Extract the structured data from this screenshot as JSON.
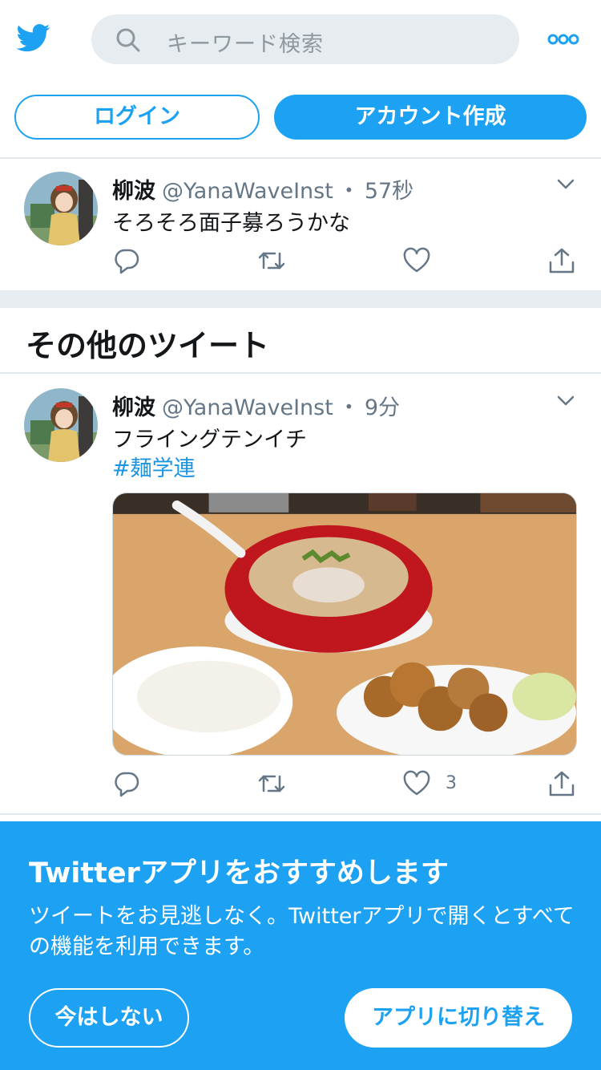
{
  "header": {
    "search_placeholder": "キーワード検索"
  },
  "auth": {
    "login_label": "ログイン",
    "signup_label": "アカウント作成"
  },
  "tweet1": {
    "name": "柳波",
    "handle": "@YanaWaveInst",
    "dot": "・",
    "time": "57秒",
    "text": "そろそろ面子募ろうかな"
  },
  "section": {
    "title": "その他のツイート"
  },
  "tweet2": {
    "name": "柳波",
    "handle": "@YanaWaveInst",
    "dot": "・",
    "time": "9分",
    "text": "フライングテンイチ",
    "hashtag": "#麺学連",
    "like_count": "3"
  },
  "promo": {
    "title": "Twitterアプリをおすすめします",
    "body": "ツイートをお見逃しなく。Twitterアプリで開くとすべての機能を利用できます。",
    "not_now_label": "今はしない",
    "switch_label": "アプリに切り替え"
  },
  "colors": {
    "brand": "#1da1f2",
    "text": "#14171a",
    "secondary": "#657786",
    "divider": "#e6ecf0"
  },
  "icons": {
    "logo": "twitter-bird-icon",
    "search": "search-icon",
    "more": "more-dots-icon",
    "chevron": "chevron-down-icon",
    "reply": "reply-icon",
    "retweet": "retweet-icon",
    "like": "like-heart-icon",
    "share": "share-icon"
  }
}
